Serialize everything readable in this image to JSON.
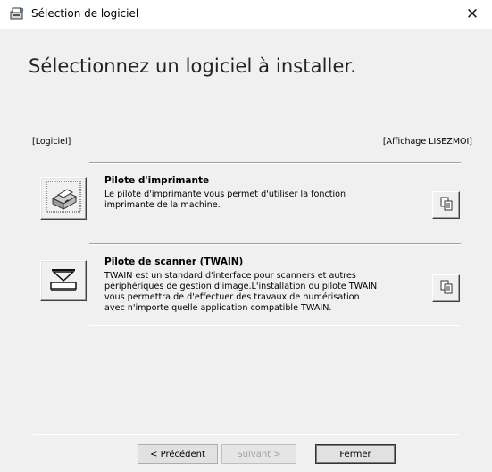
{
  "window": {
    "title": "Sélection de logiciel",
    "close_glyph": "✕",
    "app_icon": "installer-icon"
  },
  "main": {
    "headline": "Sélectionnez un logiciel à installer.",
    "section_label": "[Logiciel]",
    "readme_label": "[Affichage LISEZMOI]"
  },
  "items": [
    {
      "title": "Pilote d'imprimante",
      "description": "Le pilote d'imprimante vous permet d'utiliser la fonction\nimprimante de la machine.",
      "icon": "printer-icon",
      "readme_icon": "document-copy-icon"
    },
    {
      "title": "Pilote de scanner (TWAIN)",
      "description": "TWAIN est un standard d'interface pour scanners et autres\npériphériques de gestion d'image.L'installation du pilote TWAIN\nvous permettra de d'effectuer des travaux de numérisation\navec n'importe quelle application compatible TWAIN.",
      "icon": "scanner-icon",
      "readme_icon": "document-copy-icon"
    }
  ],
  "footer": {
    "back_label": "< Précédent",
    "next_label": "Suivant >",
    "close_label": "Fermer"
  }
}
